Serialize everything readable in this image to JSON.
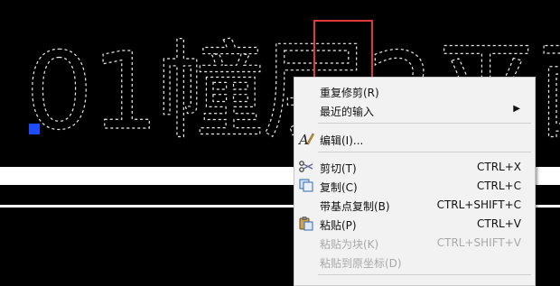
{
  "drawing": {
    "text": "01幢层2平面"
  },
  "menu": {
    "items": [
      {
        "label": "重复修剪(R)",
        "shortcut": "",
        "submenu": false,
        "disabled": false
      },
      {
        "label": "最近的输入",
        "shortcut": "",
        "submenu": true,
        "disabled": false
      },
      {
        "label": "编辑(I)...",
        "shortcut": "",
        "submenu": false,
        "disabled": false
      },
      {
        "label": "剪切(T)",
        "shortcut": "CTRL+X",
        "submenu": false,
        "disabled": false
      },
      {
        "label": "复制(C)",
        "shortcut": "CTRL+C",
        "submenu": false,
        "disabled": false
      },
      {
        "label": "带基点复制(B)",
        "shortcut": "CTRL+SHIFT+C",
        "submenu": false,
        "disabled": false
      },
      {
        "label": "粘贴(P)",
        "shortcut": "CTRL+V",
        "submenu": false,
        "disabled": false
      },
      {
        "label": "粘贴为块(K)",
        "shortcut": "CTRL+SHIFT+V",
        "submenu": false,
        "disabled": true
      },
      {
        "label": "粘贴到原坐标(D)",
        "shortcut": "",
        "submenu": false,
        "disabled": true
      }
    ],
    "submenu_arrow": "▶"
  },
  "colors": {
    "background": "#000000",
    "highlight": "#e0383b",
    "grip": "#1f4cff"
  }
}
